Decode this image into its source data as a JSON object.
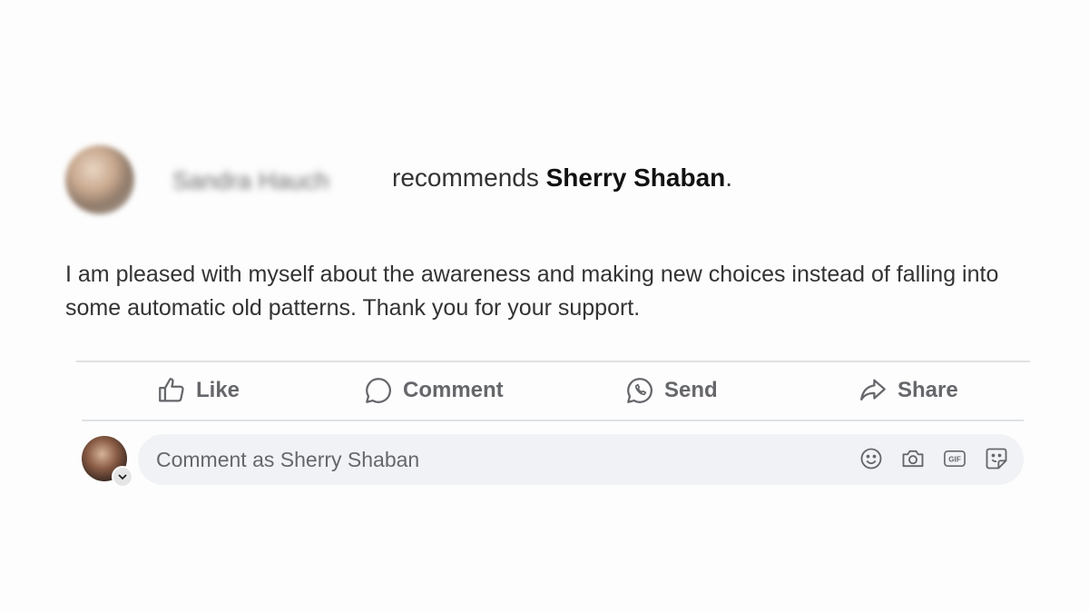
{
  "post": {
    "author_name": "Sandra Hauch",
    "recommend_verb": "recommends",
    "recommended_page": "Sherry Shaban",
    "recommend_suffix": ".",
    "body": "I am pleased with myself about the awareness and making new choices instead of falling into some automatic old patterns. Thank you for your support."
  },
  "actions": {
    "like": "Like",
    "comment": "Comment",
    "send": "Send",
    "share": "Share"
  },
  "comment_box": {
    "placeholder": "Comment as Sherry Shaban",
    "tools": [
      "emoji-icon",
      "camera-icon",
      "gif-icon",
      "sticker-icon"
    ]
  },
  "colors": {
    "action_text": "#65676b",
    "comment_bg": "#f0f2f5",
    "divider": "#dfe1e4"
  }
}
